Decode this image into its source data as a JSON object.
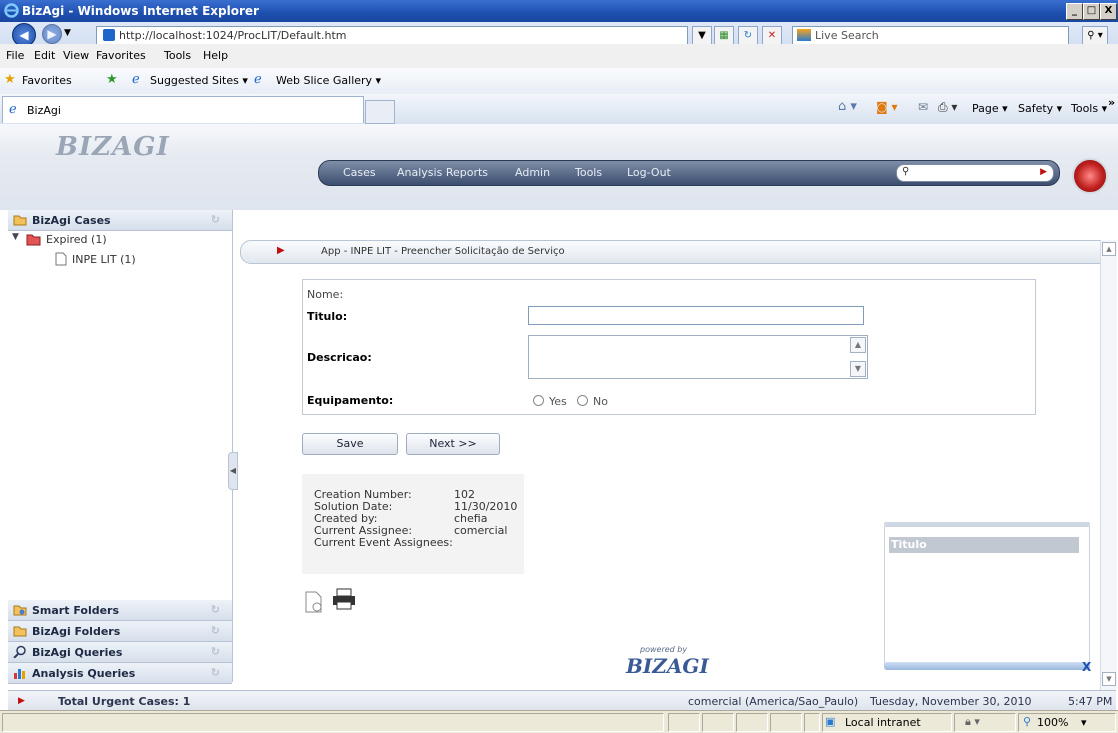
{
  "window": {
    "title": "BizAgi - Windows Internet Explorer",
    "min": "_",
    "max": "□",
    "close": "X"
  },
  "browser": {
    "address": "http://localhost:1024/ProcLIT/Default.htm",
    "search_placeholder": "Live Search",
    "menu": [
      "File",
      "Edit",
      "View",
      "Favorites",
      "Tools",
      "Help"
    ],
    "favorites_label": "Favorites",
    "suggested_sites": "Suggested Sites ▾",
    "web_slice": "Web Slice Gallery ▾",
    "tab_title": "BizAgi",
    "cmd_page": "Page ▾",
    "cmd_safety": "Safety ▾",
    "cmd_tools": "Tools ▾",
    "cmd_more": "»"
  },
  "bizagi": {
    "logo": "BIZAGI",
    "menu": [
      "Cases",
      "Analysis Reports",
      "Admin",
      "Tools",
      "Log-Out"
    ],
    "breadcrumb": "App - INPE LIT - Preencher Solicitação de Serviço"
  },
  "sidebar": {
    "cases_header": "BizAgi Cases",
    "expired": "Expired (1)",
    "inpe": "INPE LIT (1)",
    "smart_folders": "Smart Folders",
    "bizagi_folders": "BizAgi Folders",
    "bizagi_queries": "BizAgi Queries",
    "analysis_queries": "Analysis Queries"
  },
  "form": {
    "nome_label": "Nome:",
    "titulo_label": "Titulo:",
    "titulo_value": "",
    "descricao_label": "Descricao:",
    "equipamento_label": "Equipamento:",
    "yes_label": "Yes",
    "no_label": "No",
    "save_button": "Save",
    "next_button": "Next >>"
  },
  "info": {
    "creation_number_label": "Creation Number:",
    "creation_number": "102",
    "solution_date_label": "Solution Date:",
    "solution_date": "11/30/2010",
    "created_by_label": "Created by:",
    "created_by": "chefia",
    "current_assignee_label": "Current Assignee:",
    "current_assignee": "comercial",
    "current_event_assignees_label": "Current Event Assignees:"
  },
  "widget": {
    "header": "Titulo",
    "close": "X"
  },
  "powered_by": {
    "line1": "powered by",
    "logo": "BIZAGI"
  },
  "status": {
    "urgent": "Total Urgent Cases: 1",
    "user": "comercial (America/Sao_Paulo)",
    "date": "Tuesday, November 30, 2010",
    "time": "5:47 PM"
  },
  "ie_status": {
    "zone": "Local intranet",
    "zoom": "100%"
  },
  "colors": {
    "accent": "#3c4e6f",
    "arrow": "#c01010"
  }
}
